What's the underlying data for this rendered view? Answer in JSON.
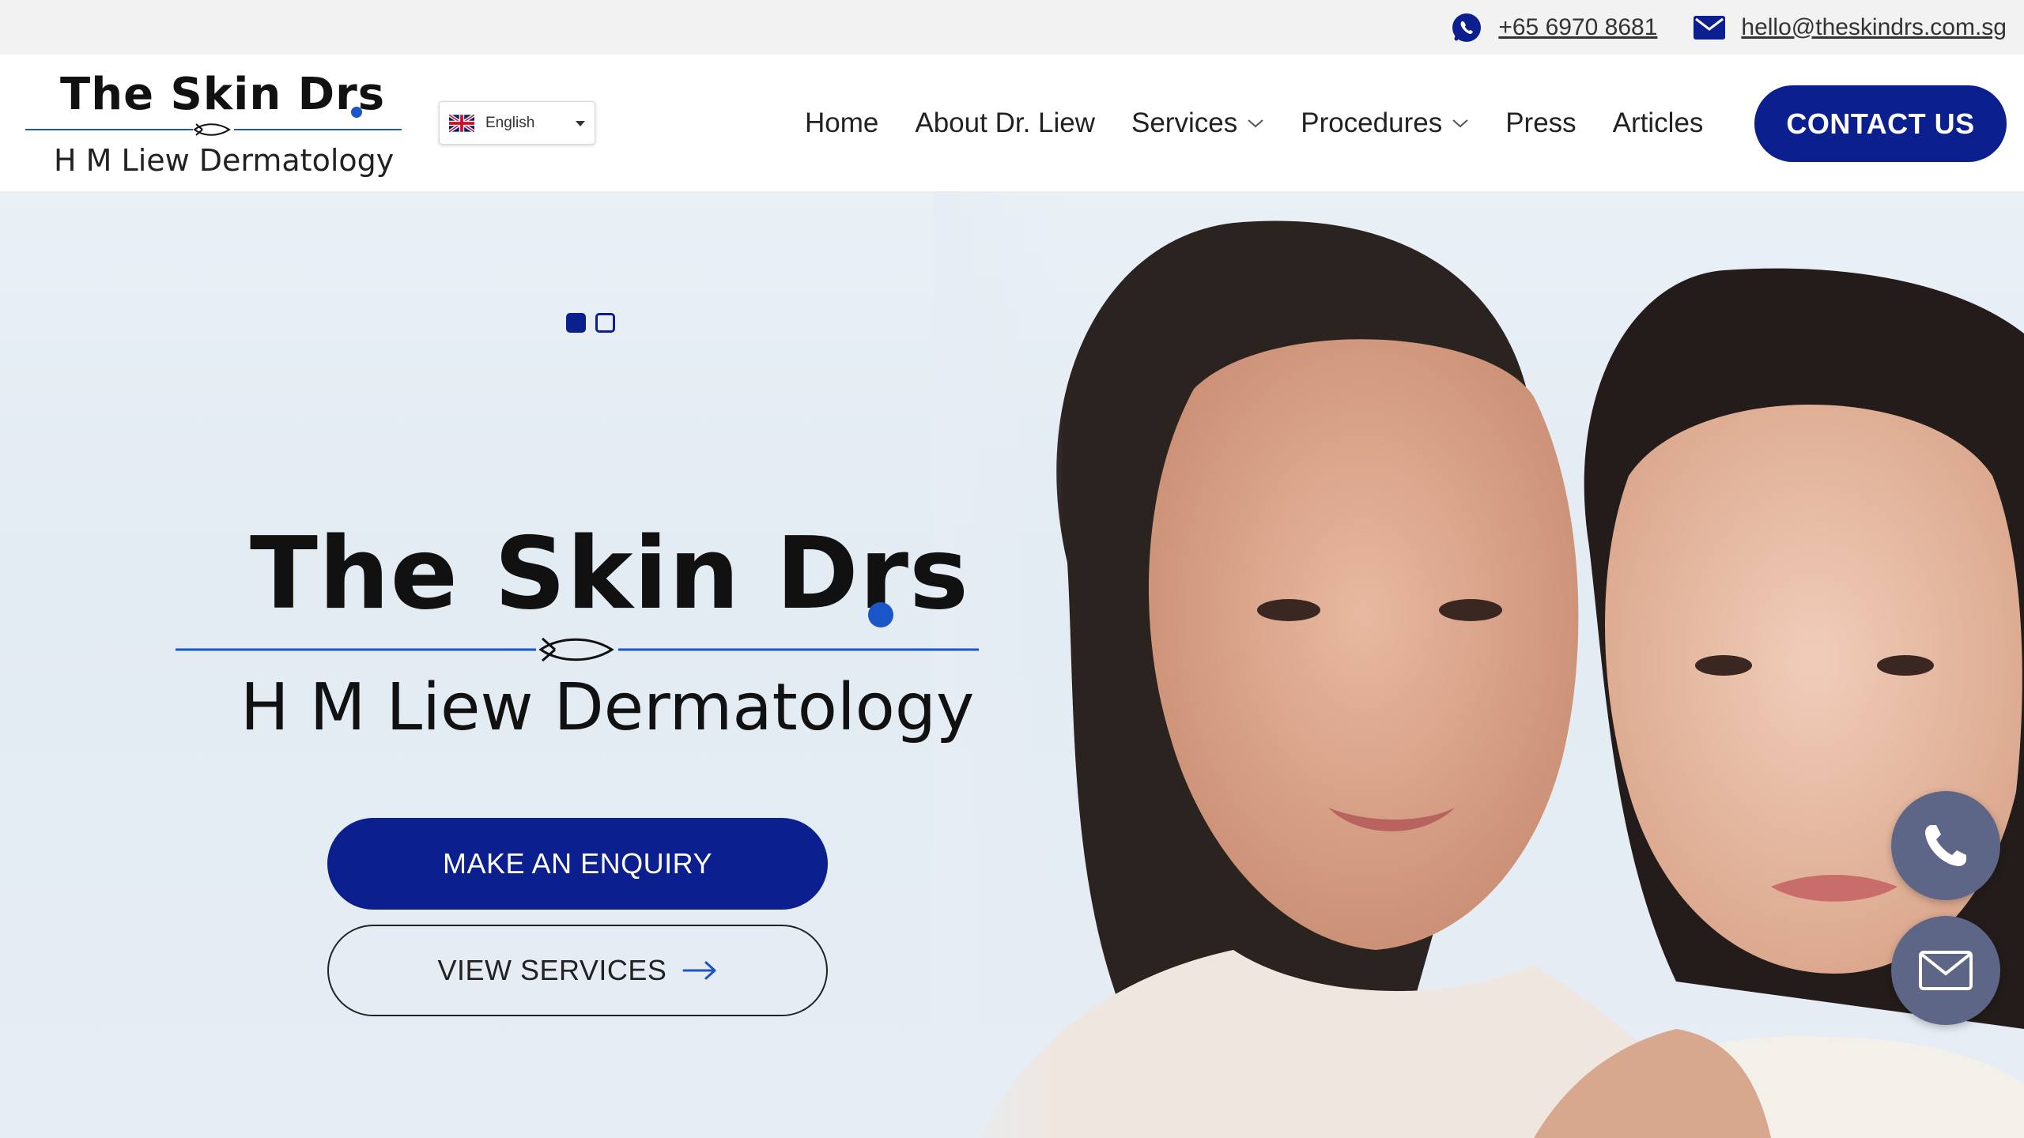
{
  "topbar": {
    "phone": "+65 6970 8681",
    "email": "hello@theskindrs.com.sg",
    "phone_icon": "whatsapp-icon",
    "email_icon": "envelope-icon"
  },
  "brand": {
    "name": "The Skin Drs",
    "dot": ".",
    "subtitle": "H M Liew Dermatology",
    "accent_color": "#1a56c8",
    "primary_color": "#0b1f8f"
  },
  "language": {
    "selected": "English",
    "flag_icon": "uk-flag-icon"
  },
  "nav": {
    "items": [
      {
        "label": "Home",
        "has_dropdown": false
      },
      {
        "label": "About Dr. Liew",
        "has_dropdown": false
      },
      {
        "label": "Services",
        "has_dropdown": true
      },
      {
        "label": "Procedures",
        "has_dropdown": true
      },
      {
        "label": "Press",
        "has_dropdown": false
      },
      {
        "label": "Articles",
        "has_dropdown": false
      }
    ],
    "contact_label": "CONTACT US"
  },
  "hero": {
    "slide_count": 2,
    "active_slide": 1,
    "title": "The Skin Drs",
    "subtitle": "H M Liew Dermatology",
    "enquiry_label": "MAKE AN ENQUIRY",
    "services_label": "VIEW SERVICES"
  },
  "floating": {
    "call_icon": "phone-icon",
    "mail_icon": "mail-icon"
  }
}
